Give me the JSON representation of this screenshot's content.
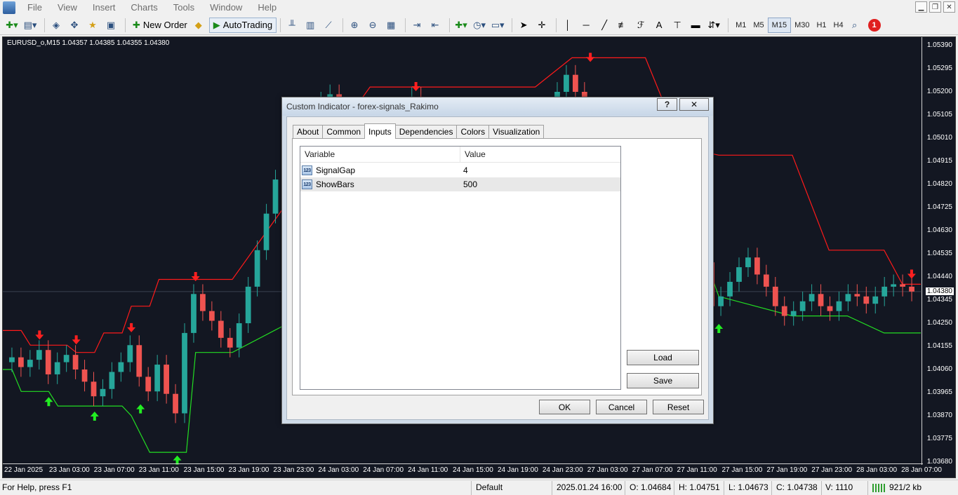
{
  "menu": {
    "items": [
      "File",
      "View",
      "Insert",
      "Charts",
      "Tools",
      "Window",
      "Help"
    ]
  },
  "toolbar": {
    "new_order_label": "New Order",
    "autotrading_label": "AutoTrading",
    "timeframes": [
      "M1",
      "M5",
      "M15",
      "M30",
      "H1",
      "H4"
    ],
    "active_timeframe": "M15",
    "notification_count": "1"
  },
  "chart": {
    "header": "EURUSD_o,M15  1.04357 1.04385 1.04355 1.04380",
    "current_price": "1.04380",
    "background": "#131722",
    "bull_color": "#26a69a",
    "bear_color": "#ef5350",
    "upper_band_color": "#ff1a1a",
    "lower_band_color": "#22dd22"
  },
  "chart_data": {
    "type": "candlestick",
    "symbol": "EURUSD_o",
    "timeframe": "M15",
    "ohlc": {
      "open": 1.04357,
      "high": 1.04385,
      "low": 1.04355,
      "close": 1.0438
    },
    "y_ticks": [
      "1.05390",
      "1.05295",
      "1.05200",
      "1.05105",
      "1.05010",
      "1.04915",
      "1.04820",
      "1.04725",
      "1.04630",
      "1.04535",
      "1.04440",
      "1.04345",
      "1.04250",
      "1.04155",
      "1.04060",
      "1.03965",
      "1.03870",
      "1.03775",
      "1.03680"
    ],
    "y_range": [
      1.0368,
      1.0539
    ],
    "x_ticks": [
      "22 Jan 2025",
      "23 Jan 03:00",
      "23 Jan 07:00",
      "23 Jan 11:00",
      "23 Jan 15:00",
      "23 Jan 19:00",
      "23 Jan 23:00",
      "24 Jan 03:00",
      "24 Jan 07:00",
      "24 Jan 11:00",
      "24 Jan 15:00",
      "24 Jan 19:00",
      "24 Jan 23:00",
      "27 Jan 03:00",
      "27 Jan 07:00",
      "27 Jan 11:00",
      "27 Jan 15:00",
      "27 Jan 19:00",
      "27 Jan 23:00",
      "28 Jan 03:00",
      "28 Jan 07:00"
    ],
    "upper_band": [
      [
        0,
        1.0422
      ],
      [
        2,
        1.0422
      ],
      [
        3,
        1.0416
      ],
      [
        7,
        1.0416
      ],
      [
        8,
        1.0413
      ],
      [
        10,
        1.0413
      ],
      [
        11,
        1.0421
      ],
      [
        13,
        1.0421
      ],
      [
        14,
        1.0432
      ],
      [
        16,
        1.0432
      ],
      [
        17,
        1.0443
      ],
      [
        25,
        1.0443
      ],
      [
        40,
        1.0522
      ],
      [
        46,
        1.0522
      ],
      [
        58,
        1.0522
      ],
      [
        62,
        1.0534
      ],
      [
        70,
        1.0534
      ],
      [
        74,
        1.0497
      ],
      [
        78,
        1.0494
      ],
      [
        86,
        1.0494
      ],
      [
        90,
        1.0455
      ],
      [
        96,
        1.0455
      ],
      [
        98,
        1.0441
      ],
      [
        100,
        1.0441
      ]
    ],
    "lower_band": [
      [
        0,
        1.0406
      ],
      [
        1,
        1.0406
      ],
      [
        2,
        1.0397
      ],
      [
        5,
        1.0397
      ],
      [
        6,
        1.0391
      ],
      [
        13,
        1.0391
      ],
      [
        14,
        1.0387
      ],
      [
        16,
        1.0372
      ],
      [
        20,
        1.0372
      ],
      [
        21,
        1.0413
      ],
      [
        25,
        1.0413
      ],
      [
        58,
        1.0478
      ],
      [
        62,
        1.0497
      ],
      [
        66,
        1.0485
      ],
      [
        70,
        1.0478
      ],
      [
        74,
        1.0478
      ],
      [
        78,
        1.0436
      ],
      [
        86,
        1.0428
      ],
      [
        92,
        1.0428
      ],
      [
        96,
        1.0421
      ],
      [
        100,
        1.0421
      ]
    ],
    "signals": [
      {
        "type": "sell",
        "x": 4,
        "price": 1.0418
      },
      {
        "type": "sell",
        "x": 8,
        "price": 1.0416
      },
      {
        "type": "sell",
        "x": 14,
        "price": 1.0421
      },
      {
        "type": "sell",
        "x": 21,
        "price": 1.0442
      },
      {
        "type": "sell",
        "x": 45,
        "price": 1.052
      },
      {
        "type": "sell",
        "x": 64,
        "price": 1.0532
      },
      {
        "type": "sell",
        "x": 99,
        "price": 1.0443
      },
      {
        "type": "buy",
        "x": 5,
        "price": 1.0395
      },
      {
        "type": "buy",
        "x": 10,
        "price": 1.0389
      },
      {
        "type": "buy",
        "x": 15,
        "price": 1.0392
      },
      {
        "type": "buy",
        "x": 19,
        "price": 1.0371
      },
      {
        "type": "buy",
        "x": 71,
        "price": 1.048
      },
      {
        "type": "buy",
        "x": 78,
        "price": 1.0425
      }
    ],
    "close_series": [
      1.0409,
      1.0411,
      1.0407,
      1.041,
      1.0414,
      1.0404,
      1.0409,
      1.0412,
      1.0406,
      1.0401,
      1.0395,
      1.0398,
      1.0405,
      1.0409,
      1.0416,
      1.0403,
      1.0397,
      1.0408,
      1.0396,
      1.0388,
      1.0421,
      1.0437,
      1.043,
      1.0426,
      1.0419,
      1.0415,
      1.0425,
      1.044,
      1.0455,
      1.047,
      1.0484,
      1.0497,
      1.0508,
      1.0512,
      1.0514,
      1.0516,
      1.0519,
      1.0509,
      1.0504,
      1.0498,
      1.05,
      1.0494,
      1.0492,
      1.0503,
      1.0511,
      1.0518,
      1.051,
      1.0505,
      1.0501,
      1.0497,
      1.0488,
      1.0482,
      1.0476,
      1.0471,
      1.0468,
      1.0465,
      1.0463,
      1.047,
      1.0478,
      1.049,
      1.0505,
      1.052,
      1.0527,
      1.052,
      1.0508,
      1.0504,
      1.05,
      1.0493,
      1.0489,
      1.0486,
      1.0482,
      1.0487,
      1.0491,
      1.0494,
      1.0489,
      1.0486,
      1.047,
      1.045,
      1.0432,
      1.0436,
      1.0442,
      1.0448,
      1.0452,
      1.0445,
      1.044,
      1.0432,
      1.0428,
      1.043,
      1.0434,
      1.0437,
      1.0432,
      1.043,
      1.0434,
      1.0437,
      1.0436,
      1.0433,
      1.0436,
      1.044,
      1.0441,
      1.044,
      1.0438
    ]
  },
  "dialog": {
    "title": "Custom Indicator - forex-signals_Rakimo",
    "help_label": "?",
    "close_label": "✕",
    "tabs": [
      "About",
      "Common",
      "Inputs",
      "Dependencies",
      "Colors",
      "Visualization"
    ],
    "active_tab": "Inputs",
    "grid": {
      "col_variable": "Variable",
      "col_value": "Value",
      "icon_text": "123",
      "rows": [
        {
          "variable": "SignalGap",
          "value": "4"
        },
        {
          "variable": "ShowBars",
          "value": "500"
        }
      ]
    },
    "load_label": "Load",
    "save_label": "Save",
    "ok_label": "OK",
    "cancel_label": "Cancel",
    "reset_label": "Reset"
  },
  "status": {
    "help": "For Help, press F1",
    "profile": "Default",
    "datetime": "2025.01.24 16:00",
    "open": "O: 1.04684",
    "high": "H: 1.04751",
    "low": "L: 1.04673",
    "close": "C: 1.04738",
    "volume": "V: 1110",
    "traffic": "921/2 kb"
  }
}
